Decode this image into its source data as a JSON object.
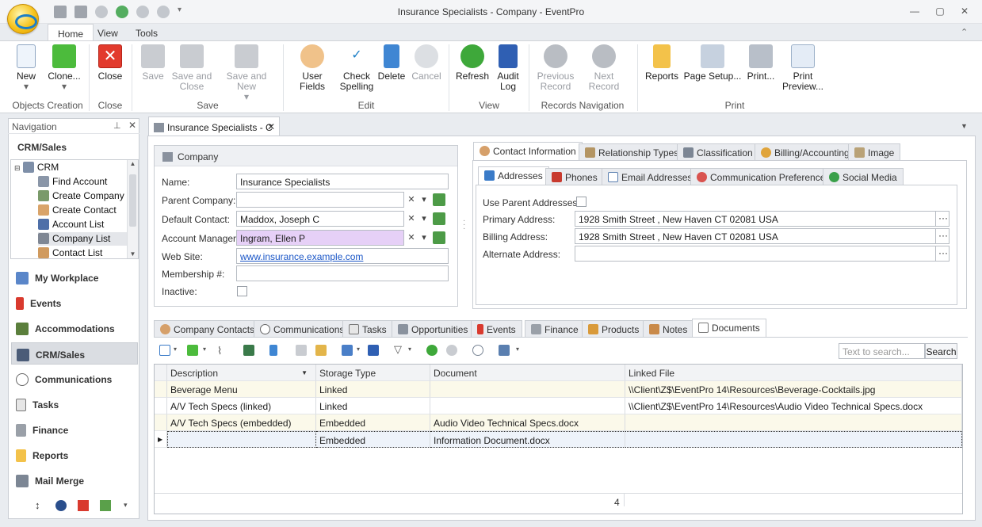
{
  "window": {
    "title": "Insurance Specialists - Company - EventPro"
  },
  "ribbon": {
    "tabs": [
      "Home",
      "View",
      "Tools"
    ],
    "groups": {
      "objects_creation": "Objects Creation",
      "close": "Close",
      "save": "Save",
      "edit": "Edit",
      "view": "View",
      "records_navigation": "Records Navigation",
      "print": "Print"
    },
    "buttons": {
      "new": "New",
      "clone": "Clone...",
      "close": "Close",
      "save": "Save",
      "save_and_close": "Save and Close",
      "save_and_new": "Save and New",
      "user_fields": "User Fields",
      "check_spelling": "Check Spelling",
      "delete": "Delete",
      "cancel": "Cancel",
      "refresh": "Refresh",
      "audit_log": "Audit Log",
      "previous_record": "Previous Record",
      "next_record": "Next Record",
      "reports": "Reports",
      "page_setup": "Page Setup...",
      "print": "Print...",
      "print_preview": "Print Preview..."
    }
  },
  "navigation": {
    "header": "Navigation",
    "section": "CRM/Sales",
    "tree": {
      "root": "CRM",
      "items": [
        "Find Account",
        "Create Company",
        "Create Contact",
        "Account List",
        "Company List",
        "Contact List"
      ],
      "selected": "Company List"
    },
    "buttons": [
      "My Workplace",
      "Events",
      "Accommodations",
      "CRM/Sales",
      "Communications",
      "Tasks",
      "Finance",
      "Reports",
      "Mail Merge"
    ],
    "active": "CRM/Sales"
  },
  "document_tab": {
    "label": "Insurance Specialists - C"
  },
  "company": {
    "group_title": "Company",
    "labels": {
      "name": "Name:",
      "parent_company": "Parent Company:",
      "default_contact": "Default Contact:",
      "account_manager": "Account Manager:",
      "web_site": "Web Site:",
      "membership": "Membership #:",
      "inactive": "Inactive:"
    },
    "values": {
      "name": "Insurance Specialists",
      "parent_company": "",
      "default_contact": "Maddox, Joseph C",
      "account_manager": "Ingram, Ellen P",
      "web_site": "www.insurance.example.com",
      "membership": ""
    }
  },
  "contact_tabs": [
    "Contact Information",
    "Relationship Types",
    "Classification",
    "Billing/Accounting",
    "Image"
  ],
  "contact_subtabs": [
    "Addresses",
    "Phones",
    "Email Addresses",
    "Communication Preferences",
    "Social Media"
  ],
  "addresses": {
    "use_parent_label": "Use Parent Addresses:",
    "primary_label": "Primary Address:",
    "primary_value": "1928 Smith Street , New Haven CT 02081 USA",
    "billing_label": "Billing Address:",
    "billing_value": "1928 Smith Street , New Haven CT 02081 USA",
    "alternate_label": "Alternate Address:",
    "alternate_value": ""
  },
  "bottom_tabs": [
    "Company Contacts",
    "Communications",
    "Tasks",
    "Opportunities",
    "Events",
    "Finance",
    "Products",
    "Notes",
    "Documents"
  ],
  "documents": {
    "search_placeholder": "Text to search...",
    "search_button": "Search",
    "columns": [
      "Description",
      "Storage Type",
      "Document",
      "Linked File"
    ],
    "rows": [
      {
        "description": "Beverage Menu",
        "storage": "Linked",
        "document": "",
        "linked": "\\\\Client\\Z$\\EventPro 14\\Resources\\Beverage-Cocktails.jpg"
      },
      {
        "description": "A/V Tech Specs (linked)",
        "storage": "Linked",
        "document": "",
        "linked": "\\\\Client\\Z$\\EventPro 14\\Resources\\Audio Video Technical Specs.docx"
      },
      {
        "description": "A/V Tech Specs (embedded)",
        "storage": "Embedded",
        "document": "Audio Video Technical Specs.docx",
        "linked": ""
      },
      {
        "description": "",
        "storage": "Embedded",
        "document": "Information Document.docx",
        "linked": ""
      }
    ],
    "count": "4"
  },
  "colors": {
    "accent": "#1c7fc7",
    "highlight_purple": "#e6d0f7",
    "row_alt": "#fbf9ea"
  }
}
